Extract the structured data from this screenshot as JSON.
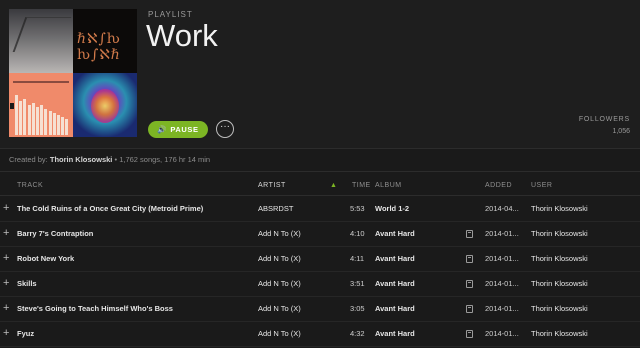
{
  "playlist": {
    "type_label": "PLAYLIST",
    "title": "Work",
    "play_label": "PAUSE",
    "more_label": "···",
    "followers_label": "FOLLOWERS",
    "followers_count": "1,056"
  },
  "meta": {
    "created_prefix": "Created by:",
    "creator": "Thorin Klosowski",
    "summary": "• 1,762 songs, 176 hr 14 min"
  },
  "cover_art": {
    "tile2_glyphs": "ℏℵ∫ƕ ƕ∫ℵℏ"
  },
  "columns": {
    "track": "TRACK",
    "artist": "ARTIST",
    "time": "TIME",
    "album": "ALBUM",
    "added": "ADDED",
    "user": "USER"
  },
  "sort_indicator": "▲",
  "tracks": [
    {
      "title": "The Cold Ruins of a Once Great City (Metroid Prime)",
      "artist": "ABSRDST",
      "time": "5:53",
      "album": "World 1-2",
      "added": "2014-04...",
      "user": "Thorin Klosowski",
      "local": false
    },
    {
      "title": "Barry 7's Contraption",
      "artist": "Add N To (X)",
      "time": "4:10",
      "album": "Avant Hard",
      "added": "2014-01...",
      "user": "Thorin Klosowski",
      "local": true
    },
    {
      "title": "Robot New York",
      "artist": "Add N To (X)",
      "time": "4:11",
      "album": "Avant Hard",
      "added": "2014-01...",
      "user": "Thorin Klosowski",
      "local": true
    },
    {
      "title": "Skills",
      "artist": "Add N To (X)",
      "time": "3:51",
      "album": "Avant Hard",
      "added": "2014-01...",
      "user": "Thorin Klosowski",
      "local": true
    },
    {
      "title": "Steve's Going to Teach Himself Who's Boss",
      "artist": "Add N To (X)",
      "time": "3:05",
      "album": "Avant Hard",
      "added": "2014-01...",
      "user": "Thorin Klosowski",
      "local": true
    },
    {
      "title": "Fyuz",
      "artist": "Add N To (X)",
      "time": "4:32",
      "album": "Avant Hard",
      "added": "2014-01...",
      "user": "Thorin Klosowski",
      "local": true
    }
  ],
  "colors": {
    "accent": "#7cb524",
    "background": "#1a1a1a"
  }
}
